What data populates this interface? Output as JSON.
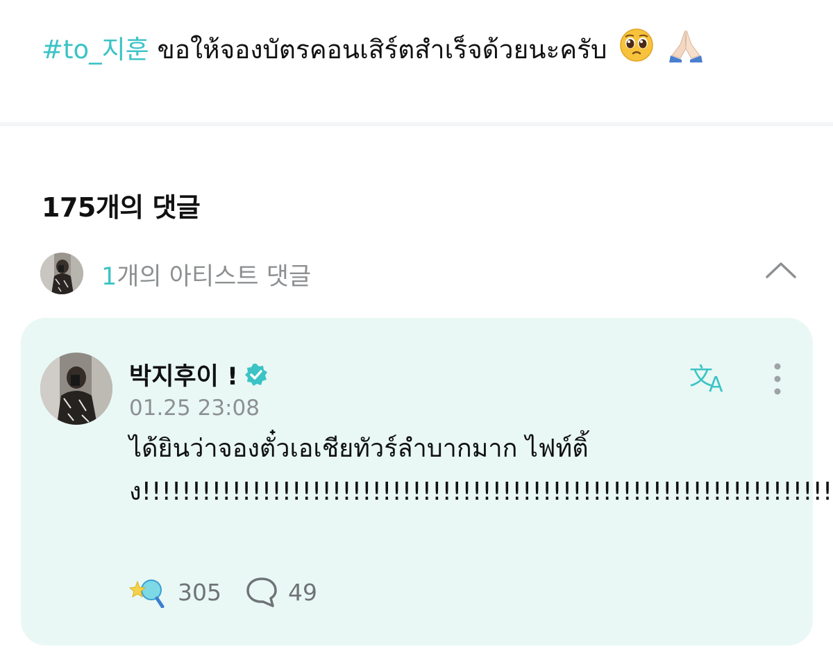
{
  "post": {
    "hashtag": "#to_지훈",
    "text": " ขอให้จองบัตรคอนเสิร์ตสำเร็จด้วยนะครับ",
    "emojis": [
      "pleading-face-emoji",
      "folded-hands-emoji"
    ]
  },
  "comments": {
    "count_label": "175개의 댓글",
    "artist_toggle": {
      "count": "1",
      "label": "개의 아티스트 댓글"
    },
    "artist_comment": {
      "author": "박지후이 !",
      "timestamp": "01.25 23:08",
      "body": "ได้ยินว่าจองตั๋วเอเชียทัวร์ลำบากมาก ไฟท์ติ้ง!!!!!!!!!!!!!!!!!!!!!!!!!!!!!!!!!!!!!!!!!!!!!!!!!!!!!!!!!!!!!!!!!!!!!!!!!!!!!!!!!!!!!!!!!!!!!!!!!!!!!",
      "likes": "305",
      "replies": "49"
    }
  },
  "colors": {
    "accent": "#3cc3c5",
    "card_background": "#e9f8f5",
    "muted_text": "#8d9092"
  }
}
